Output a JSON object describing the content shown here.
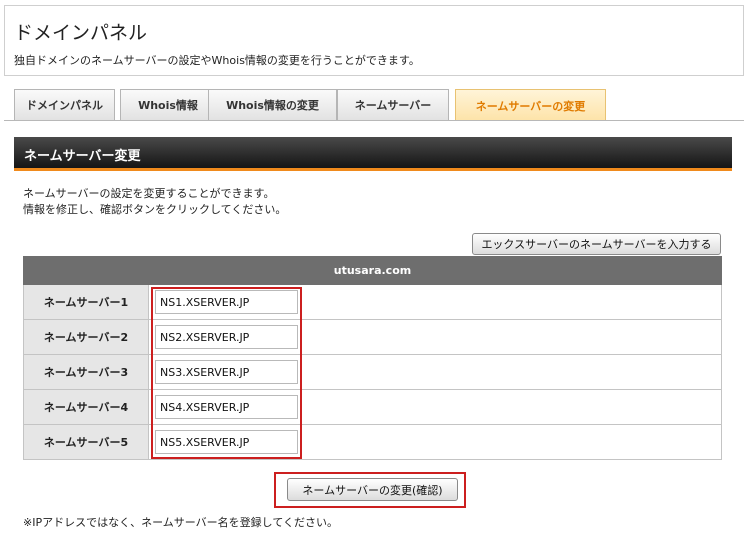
{
  "header": {
    "title": "ドメインパネル",
    "subtitle": "独自ドメインのネームサーバーの設定やWhois情報の変更を行うことができます。"
  },
  "tabs": [
    {
      "label": "ドメインパネル",
      "active": false
    },
    {
      "label": "Whois情報",
      "active": false
    },
    {
      "label": "Whois情報の変更",
      "active": false
    },
    {
      "label": "ネームサーバー",
      "active": false
    },
    {
      "label": "ネームサーバーの変更",
      "active": true
    }
  ],
  "section": {
    "title": "ネームサーバー変更",
    "desc_line1": "ネームサーバーの設定を変更することができます。",
    "desc_line2": "情報を修正し、確認ボタンをクリックしてください。"
  },
  "xserver_button_label": "エックスサーバーのネームサーバーを入力する",
  "domain": "utusara.com",
  "nameservers": [
    {
      "label": "ネームサーバー1",
      "value": "NS1.XSERVER.JP"
    },
    {
      "label": "ネームサーバー2",
      "value": "NS2.XSERVER.JP"
    },
    {
      "label": "ネームサーバー3",
      "value": "NS3.XSERVER.JP"
    },
    {
      "label": "ネームサーバー4",
      "value": "NS4.XSERVER.JP"
    },
    {
      "label": "ネームサーバー5",
      "value": "NS5.XSERVER.JP"
    }
  ],
  "confirm_button_label": "ネームサーバーの変更(確認)",
  "note": "※IPアドレスではなく、ネームサーバー名を登録してください。",
  "colors": {
    "accent": "#f08a1c",
    "active_tab_text": "#e07b00",
    "highlight": "#cc1f1f"
  }
}
